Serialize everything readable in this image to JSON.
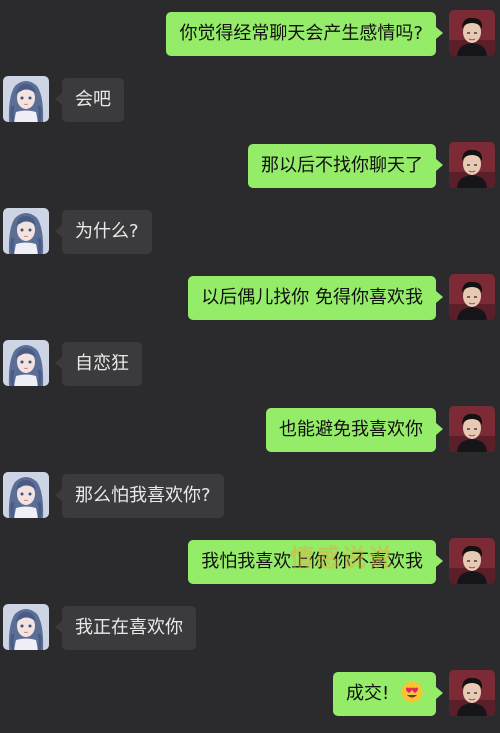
{
  "theme": {
    "background": "#2b2b2d",
    "sent_bubble": "#95ec69",
    "received_bubble": "#3b3b3d"
  },
  "messages": [
    {
      "side": "out",
      "text": "你觉得经常聊天会产生感情吗?"
    },
    {
      "side": "in",
      "text": "会吧"
    },
    {
      "side": "out",
      "text": "那以后不找你聊天了"
    },
    {
      "side": "in",
      "text": "为什么?"
    },
    {
      "side": "out",
      "text": "以后偶儿找你 免得你喜欢我"
    },
    {
      "side": "in",
      "text": "自恋狂"
    },
    {
      "side": "out",
      "text": "也能避免我喜欢你"
    },
    {
      "side": "in",
      "text": "那么怕我喜欢你?"
    },
    {
      "side": "out",
      "text": "我怕我喜欢上你 你不喜欢我"
    },
    {
      "side": "in",
      "text": "我正在喜欢你"
    },
    {
      "side": "out",
      "text": "成交!",
      "emoji": "heart-eyes-emoji"
    }
  ],
  "watermark": {
    "text": "情感说说"
  },
  "avatars": {
    "sender": "male-avatar",
    "receiver": "female-anime-avatar"
  }
}
